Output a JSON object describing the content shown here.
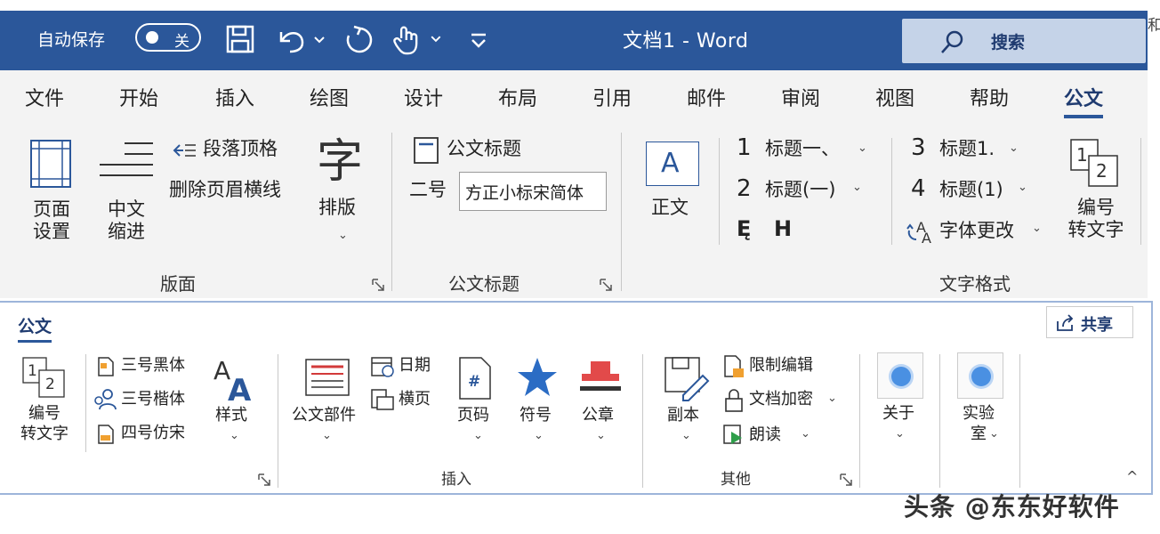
{
  "titlebar": {
    "autosave_label": "自动保存",
    "autosave_state": "关",
    "window_title": "文档1  -  Word",
    "search_label": "搜索",
    "accent": "#2b579a"
  },
  "corner_char": "和",
  "tabs": [
    {
      "label": "文件"
    },
    {
      "label": "开始"
    },
    {
      "label": "插入"
    },
    {
      "label": "绘图"
    },
    {
      "label": "设计"
    },
    {
      "label": "布局"
    },
    {
      "label": "引用"
    },
    {
      "label": "邮件"
    },
    {
      "label": "审阅"
    },
    {
      "label": "视图"
    },
    {
      "label": "帮助"
    },
    {
      "label": "公文",
      "active": true
    }
  ],
  "ribbon1": {
    "layout_group": {
      "page_setup_1": "页面",
      "page_setup_2": "设置",
      "indent_1": "中文",
      "indent_2": "缩进",
      "para_top": "段落顶格",
      "remove_header_line": "删除页眉横线",
      "typeset_glyph": "字",
      "typeset": "排版",
      "label": "版面"
    },
    "title_group": {
      "doc_title": "公文标题",
      "size_label": "二号",
      "font_value": "方正小标宋简体",
      "label": "公文标题"
    },
    "format_group": {
      "body_glyph": "A",
      "body": "正文",
      "h1_num": "1",
      "h1": "标题一、",
      "h2_num": "2",
      "h2": "标题(一)",
      "h3_num": "3",
      "h3": "标题1.",
      "h4_num": "4",
      "h4": "标题(1)",
      "e_mark": "Ę",
      "h_mark": "H",
      "font_change": "字体更改",
      "num_to_text_1": "编号",
      "num_to_text_2": "转文字",
      "label": "文字格式"
    }
  },
  "ribbon2": {
    "tab": "公文",
    "share": "共享",
    "num_to_text_1": "编号",
    "num_to_text_2": "转文字",
    "font_hei": "三号黑体",
    "font_kai": "三号楷体",
    "font_fang": "四号仿宋",
    "style_glyph": "A",
    "style": "样式",
    "doc_parts": "公文部件",
    "date": "日期",
    "landscape": "横页",
    "page_num": "页码",
    "symbol": "符号",
    "seal": "公章",
    "insert_group": "插入",
    "copy": "副本",
    "restrict": "限制编辑",
    "encrypt": "文档加密",
    "read": "朗读",
    "other_group": "其他",
    "about": "关于",
    "lab_1": "实验",
    "lab_2": "室"
  },
  "watermark": "头条 @东东好软件"
}
